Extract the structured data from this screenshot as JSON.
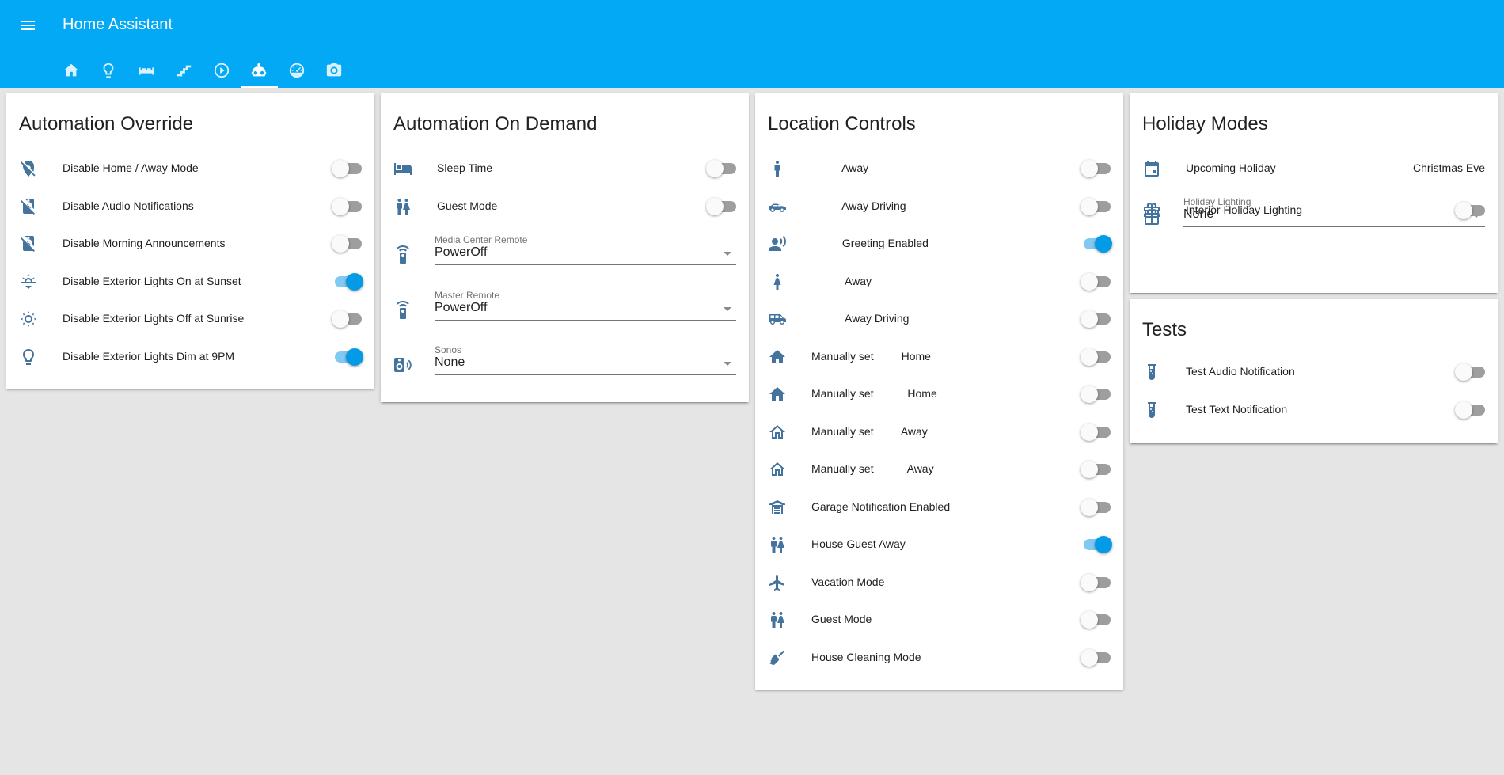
{
  "app": {
    "title": "Home Assistant",
    "menu_icon": "menu-icon"
  },
  "tabs": [
    {
      "icon": "home-icon",
      "active": false
    },
    {
      "icon": "lightbulb-icon",
      "active": false
    },
    {
      "icon": "sofa-icon",
      "active": false
    },
    {
      "icon": "stairs-icon",
      "active": false
    },
    {
      "icon": "play-circle-icon",
      "active": false
    },
    {
      "icon": "robot-icon",
      "active": true
    },
    {
      "icon": "gauge-icon",
      "active": false
    },
    {
      "icon": "camera-icon",
      "active": false
    }
  ],
  "colors": {
    "primary": "#03a9f4",
    "icon": "#44739e",
    "toggle_on": "#039be5",
    "toggle_on_track": "#81c9f2",
    "toggle_off_track": "#9e9e9e",
    "background": "#e5e5e5"
  },
  "cards": {
    "automation_override": {
      "title": "Automation Override",
      "rows": [
        {
          "icon": "map-marker-off-icon",
          "label": "Disable Home / Away Mode",
          "on": false
        },
        {
          "icon": "speaker-off-icon",
          "label": "Disable Audio Notifications",
          "on": false
        },
        {
          "icon": "speaker-off-icon",
          "label": "Disable Morning Announcements",
          "on": false
        },
        {
          "icon": "weather-sunset-down-icon",
          "label": "Disable Exterior Lights On at Sunset",
          "on": true
        },
        {
          "icon": "weather-sunset-up-icon",
          "label": "Disable Exterior Lights Off at Sunrise",
          "on": false
        },
        {
          "icon": "lightbulb-outline-icon",
          "label": "Disable Exterior Lights Dim at 9PM",
          "on": true
        }
      ]
    },
    "automation_on_demand": {
      "title": "Automation On Demand",
      "rows": [
        {
          "icon": "bed-icon",
          "label": "Sleep Time",
          "on": false
        },
        {
          "icon": "human-male-female-icon",
          "label": "Guest Mode",
          "on": false
        }
      ],
      "selects": [
        {
          "icon": "remote-icon",
          "label": "Media Center Remote",
          "value": "PowerOff"
        },
        {
          "icon": "remote-icon",
          "label": "Master Remote",
          "value": "PowerOff"
        },
        {
          "icon": "speaker-wireless-icon",
          "label": "Sonos",
          "value": "None"
        }
      ]
    },
    "location_controls": {
      "title": "Location Controls",
      "rows": [
        {
          "icon": "human-male-icon",
          "label": "          Away",
          "on": false
        },
        {
          "icon": "car-sports-icon",
          "label": "          Away Driving",
          "on": false
        },
        {
          "icon": "account-voice-icon",
          "label": "          Greeting Enabled",
          "on": true
        },
        {
          "icon": "human-female-icon",
          "label": "           Away",
          "on": false
        },
        {
          "icon": "car-estate-icon",
          "label": "           Away Driving",
          "on": false
        },
        {
          "icon": "home-icon",
          "label": "Manually set         Home",
          "on": false
        },
        {
          "icon": "home-icon",
          "label": "Manually set           Home",
          "on": false
        },
        {
          "icon": "home-outline-icon",
          "label": "Manually set         Away",
          "on": false
        },
        {
          "icon": "home-outline-icon",
          "label": "Manually set           Away",
          "on": false
        },
        {
          "icon": "garage-icon",
          "label": "Garage Notification Enabled",
          "on": false
        },
        {
          "icon": "human-male-female-icon",
          "label": "House Guest Away",
          "on": true
        },
        {
          "icon": "airplane-icon",
          "label": "Vacation Mode",
          "on": false
        },
        {
          "icon": "human-male-female-icon",
          "label": "Guest Mode",
          "on": false
        },
        {
          "icon": "broom-icon",
          "label": "House Cleaning Mode",
          "on": false
        }
      ]
    },
    "holiday_modes": {
      "title": "Holiday Modes",
      "sensor": {
        "icon": "calendar-icon",
        "label": "Upcoming Holiday",
        "value": "Christmas Eve"
      },
      "select": {
        "icon": "gift-icon",
        "label": "Holiday Lighting",
        "value": "None"
      },
      "rows": [
        {
          "icon": "gift-icon",
          "label": "Interior Holiday Lighting",
          "on": false
        }
      ]
    },
    "tests": {
      "title": "Tests",
      "rows": [
        {
          "icon": "test-tube-icon",
          "label": "Test Audio Notification",
          "on": false
        },
        {
          "icon": "test-tube-icon",
          "label": "Test Text Notification",
          "on": false
        }
      ]
    }
  }
}
